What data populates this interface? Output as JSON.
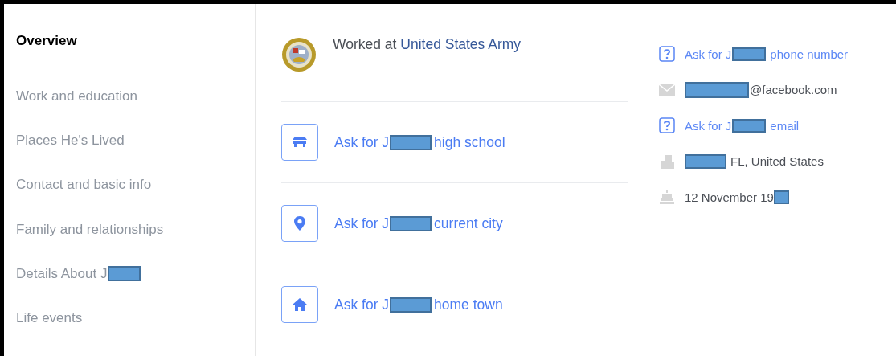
{
  "sidebar": {
    "items": [
      {
        "label": "Overview",
        "selected": true,
        "redacted": false
      },
      {
        "label": "Work and education",
        "selected": false,
        "redacted": false
      },
      {
        "label": "Places He's Lived",
        "selected": false,
        "redacted": false
      },
      {
        "label": "Contact and basic info",
        "selected": false,
        "redacted": false
      },
      {
        "label": "Family and relationships",
        "selected": false,
        "redacted": false
      },
      {
        "label": "Details About J",
        "selected": false,
        "redacted": true
      },
      {
        "label": "Life events",
        "selected": false,
        "redacted": false
      }
    ]
  },
  "work": {
    "prefix": "Worked at",
    "employer": "United States Army"
  },
  "prompts": [
    {
      "kind": "school",
      "before": "Ask for J",
      "after": "high school"
    },
    {
      "kind": "city",
      "before": "Ask for J",
      "after": "current city"
    },
    {
      "kind": "hometown",
      "before": "Ask for J",
      "after": "home town"
    }
  ],
  "contact": [
    {
      "kind": "ask",
      "before": "Ask for J",
      "after": "phone number"
    },
    {
      "kind": "email",
      "after": "@facebook.com"
    },
    {
      "kind": "ask",
      "before": "Ask for J",
      "after": "email"
    },
    {
      "kind": "location",
      "after": "FL, United States"
    },
    {
      "kind": "birthday",
      "before": "12 November 19"
    }
  ]
}
